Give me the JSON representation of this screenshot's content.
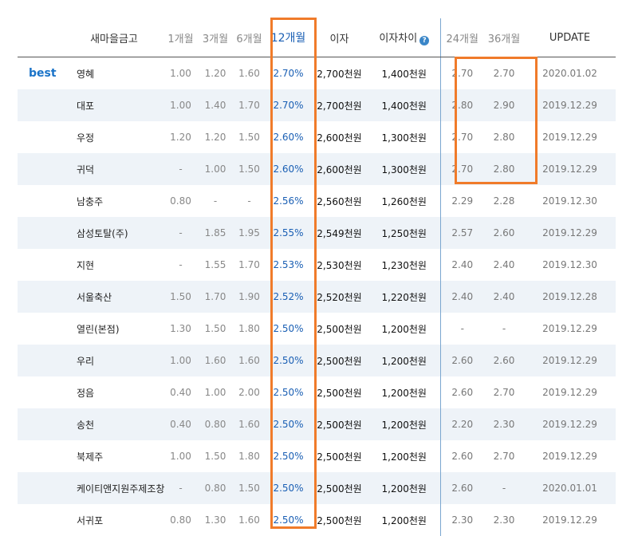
{
  "headers": {
    "bank": "새마을금고",
    "m1": "1개월",
    "m3": "3개월",
    "m6": "6개월",
    "m12": "12개월",
    "interest": "이자",
    "diff": "이자차이",
    "m24": "24개월",
    "m36": "36개월",
    "update": "UPDATE"
  },
  "help_icon": "question-icon",
  "rows": [
    {
      "best": "best",
      "name": "영혜",
      "m1": "1.00",
      "m3": "1.20",
      "m6": "1.60",
      "m12": "2.70%",
      "interest": "2,700천원",
      "diff": "1,400천원",
      "m24": "2.70",
      "m36": "2.70",
      "update": "2020.01.02"
    },
    {
      "best": "",
      "name": "대포",
      "m1": "1.00",
      "m3": "1.40",
      "m6": "1.70",
      "m12": "2.70%",
      "interest": "2,700천원",
      "diff": "1,400천원",
      "m24": "2.80",
      "m36": "2.90",
      "update": "2019.12.29"
    },
    {
      "best": "",
      "name": "우정",
      "m1": "1.20",
      "m3": "1.20",
      "m6": "1.50",
      "m12": "2.60%",
      "interest": "2,600천원",
      "diff": "1,300천원",
      "m24": "2.70",
      "m36": "2.80",
      "update": "2019.12.29"
    },
    {
      "best": "",
      "name": "귀덕",
      "m1": "-",
      "m3": "1.00",
      "m6": "1.50",
      "m12": "2.60%",
      "interest": "2,600천원",
      "diff": "1,300천원",
      "m24": "2.70",
      "m36": "2.80",
      "update": "2019.12.29"
    },
    {
      "best": "",
      "name": "남충주",
      "m1": "0.80",
      "m3": "-",
      "m6": "-",
      "m12": "2.56%",
      "interest": "2,560천원",
      "diff": "1,260천원",
      "m24": "2.29",
      "m36": "2.28",
      "update": "2019.12.30"
    },
    {
      "best": "",
      "name": "삼성토탈(주)",
      "m1": "-",
      "m3": "1.85",
      "m6": "1.95",
      "m12": "2.55%",
      "interest": "2,549천원",
      "diff": "1,250천원",
      "m24": "2.57",
      "m36": "2.60",
      "update": "2019.12.29"
    },
    {
      "best": "",
      "name": "지현",
      "m1": "-",
      "m3": "1.55",
      "m6": "1.70",
      "m12": "2.53%",
      "interest": "2,530천원",
      "diff": "1,230천원",
      "m24": "2.40",
      "m36": "2.40",
      "update": "2019.12.30"
    },
    {
      "best": "",
      "name": "서울축산",
      "m1": "1.50",
      "m3": "1.70",
      "m6": "1.90",
      "m12": "2.52%",
      "interest": "2,520천원",
      "diff": "1,220천원",
      "m24": "2.40",
      "m36": "2.40",
      "update": "2019.12.28"
    },
    {
      "best": "",
      "name": "열린(본점)",
      "m1": "1.30",
      "m3": "1.50",
      "m6": "1.80",
      "m12": "2.50%",
      "interest": "2,500천원",
      "diff": "1,200천원",
      "m24": "-",
      "m36": "-",
      "update": "2019.12.29"
    },
    {
      "best": "",
      "name": "우리",
      "m1": "1.00",
      "m3": "1.60",
      "m6": "1.60",
      "m12": "2.50%",
      "interest": "2,500천원",
      "diff": "1,200천원",
      "m24": "2.60",
      "m36": "2.60",
      "update": "2019.12.29"
    },
    {
      "best": "",
      "name": "정음",
      "m1": "0.40",
      "m3": "1.00",
      "m6": "2.00",
      "m12": "2.50%",
      "interest": "2,500천원",
      "diff": "1,200천원",
      "m24": "2.60",
      "m36": "2.70",
      "update": "2019.12.29"
    },
    {
      "best": "",
      "name": "송천",
      "m1": "0.40",
      "m3": "0.80",
      "m6": "1.60",
      "m12": "2.50%",
      "interest": "2,500천원",
      "diff": "1,200천원",
      "m24": "2.20",
      "m36": "2.30",
      "update": "2019.12.29"
    },
    {
      "best": "",
      "name": "북제주",
      "m1": "1.00",
      "m3": "1.50",
      "m6": "1.80",
      "m12": "2.50%",
      "interest": "2,500천원",
      "diff": "1,200천원",
      "m24": "2.60",
      "m36": "2.70",
      "update": "2019.12.29"
    },
    {
      "best": "",
      "name": "케이티앤지원주제조창",
      "m1": "-",
      "m3": "0.80",
      "m6": "1.50",
      "m12": "2.50%",
      "interest": "2,500천원",
      "diff": "1,200천원",
      "m24": "2.60",
      "m36": "-",
      "update": "2020.01.01"
    },
    {
      "best": "",
      "name": "서귀포",
      "m1": "0.80",
      "m3": "1.30",
      "m6": "1.60",
      "m12": "2.50%",
      "interest": "2,500천원",
      "diff": "1,200천원",
      "m24": "2.30",
      "m36": "2.30",
      "update": "2019.12.29"
    }
  ],
  "colors": {
    "highlight": "#f07b2a",
    "accent": "#1a5fb4",
    "row_alt": "#eef3f8"
  }
}
